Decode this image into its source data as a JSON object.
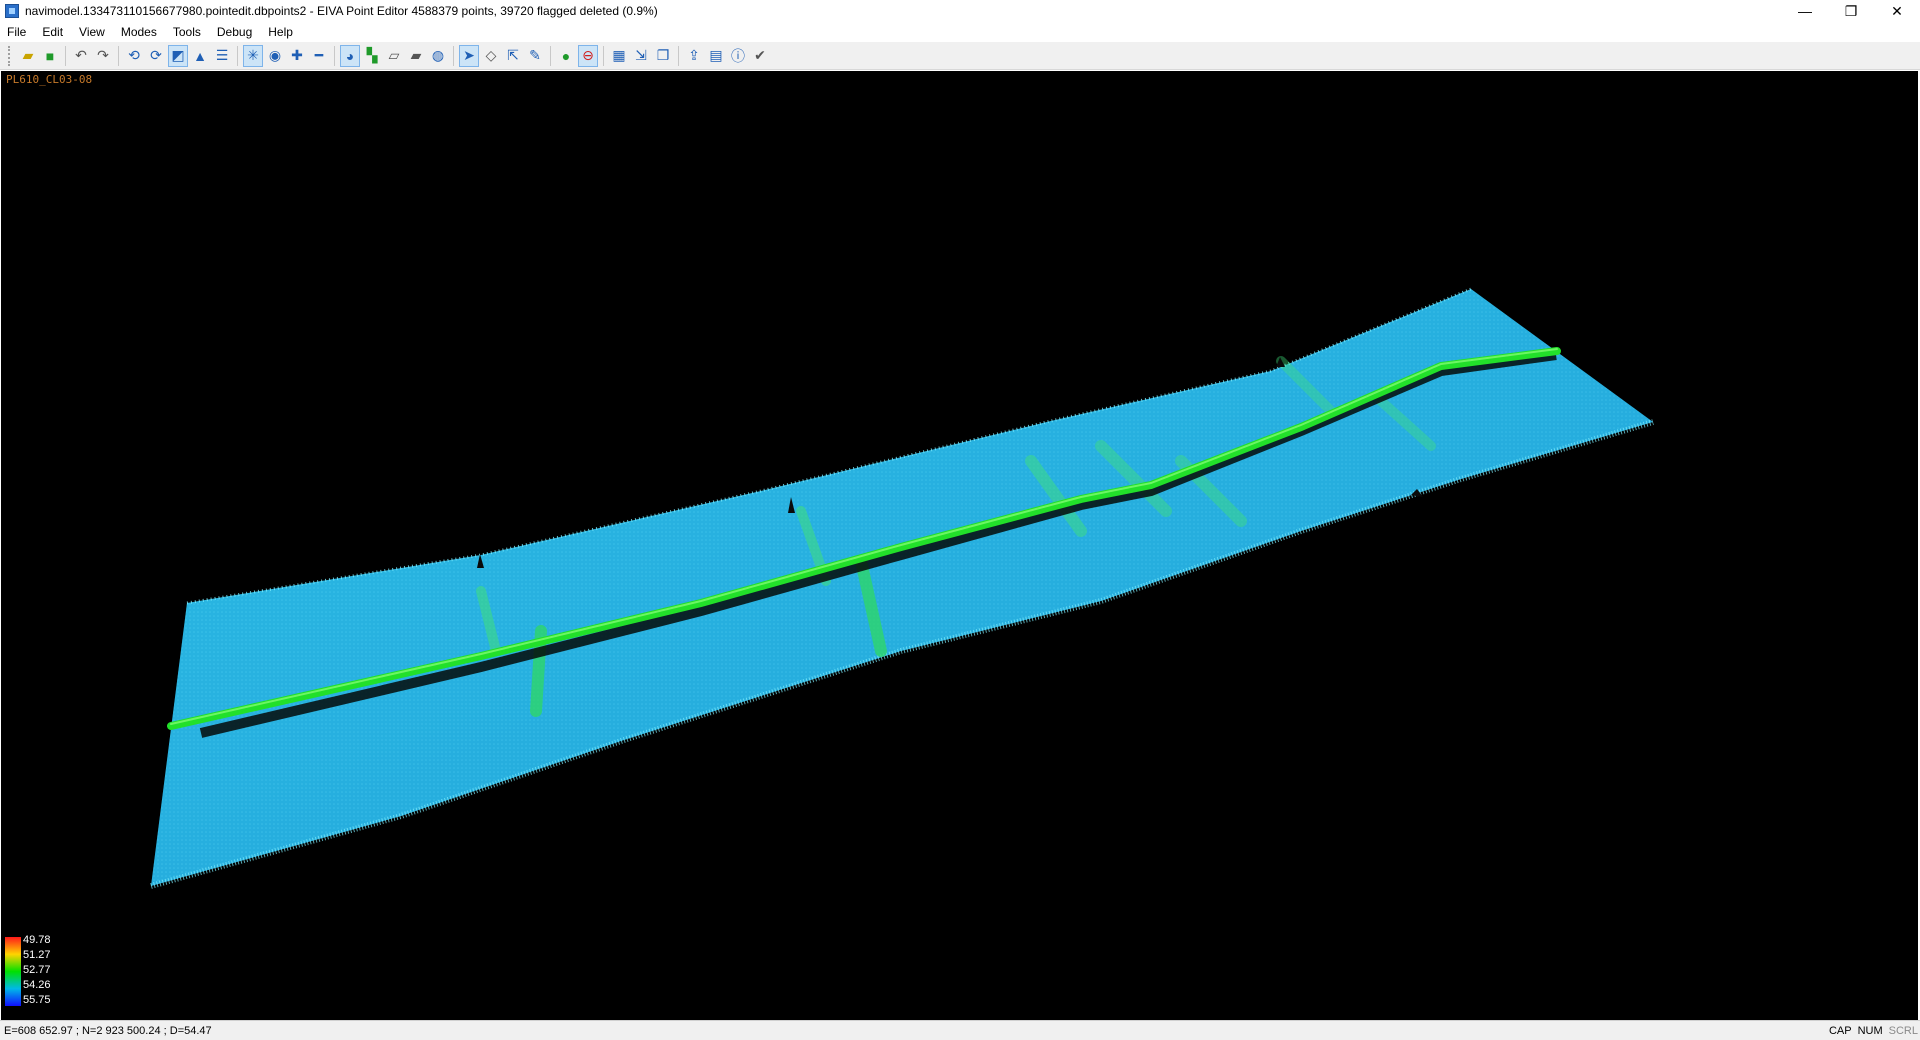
{
  "window": {
    "title": "navimodel.133473110156677980.pointedit.dbpoints2 - EIVA Point Editor 4588379 points, 39720 flagged deleted (0.9%)",
    "minimize": "—",
    "restore": "❐",
    "close": "✕"
  },
  "menu": [
    "File",
    "Edit",
    "View",
    "Modes",
    "Tools",
    "Debug",
    "Help"
  ],
  "toolbar": {
    "icons": [
      "open-icon",
      "save-icon",
      "undo-icon",
      "redo-icon",
      "rotate-icon",
      "refresh-icon",
      "cube-view-icon",
      "north-arrow-icon",
      "list-icon",
      "snowflake-icon",
      "target-icon",
      "plus-icon",
      "minus-icon",
      "color-by-depth-icon",
      "color-by-map-icon",
      "surface-icon",
      "surface-shaded-icon",
      "globe-icon",
      "select-arrow-icon",
      "eraser-icon",
      "pick-icon",
      "pen-icon",
      "info-green-icon",
      "delete-red-icon",
      "grid-icon",
      "move-icon",
      "copy-icon",
      "export-icon",
      "measure-icon",
      "info-icon",
      "check-icon"
    ]
  },
  "viewport": {
    "line_label": "PL610_CL03-08"
  },
  "legend": {
    "values": [
      "49.78",
      "51.27",
      "52.77",
      "54.26",
      "55.75"
    ],
    "colors": [
      "#ff1a1a",
      "#ffd400",
      "#00e000",
      "#00b8e8",
      "#1010ff"
    ]
  },
  "status": {
    "coords": "E=608 652.97 ; N=2 923 500.24 ; D=54.47",
    "cap": "CAP",
    "num": "NUM",
    "scrl": "SCRL"
  }
}
